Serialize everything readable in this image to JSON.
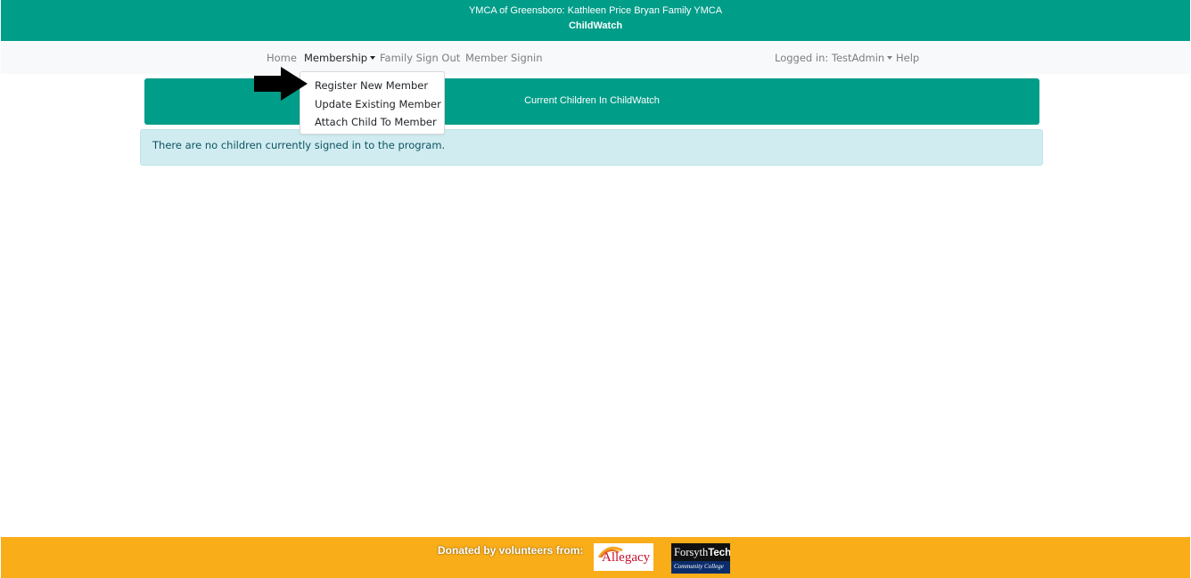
{
  "header": {
    "organization": "YMCA of Greensboro: Kathleen Price Bryan Family YMCA",
    "app_name": "ChildWatch",
    "background": "#009d89"
  },
  "nav": {
    "home": "Home",
    "membership": "Membership",
    "family_sign_out": "Family Sign Out",
    "member_signin": "Member Signin",
    "logged_in": "Logged in: TestAdmin",
    "help": "Help"
  },
  "membership_menu": {
    "items": [
      {
        "label": "Register New Member"
      },
      {
        "label": "Update Existing Member"
      },
      {
        "label": "Attach Child To Member"
      }
    ]
  },
  "main": {
    "title": "Current Children In ChildWatch",
    "empty_message": "There are no children currently signed in to the program."
  },
  "footer": {
    "donated_text": "Donated by volunteers from:",
    "background": "#f9ad19",
    "logos": {
      "allegacy": "Allegacy",
      "forsyth_prefix": "Forsyth",
      "forsyth_bold": "Tech",
      "forsyth_sub": "Community College"
    }
  },
  "annotation": {
    "icon": "arrow-right-icon",
    "color": "#000000"
  }
}
